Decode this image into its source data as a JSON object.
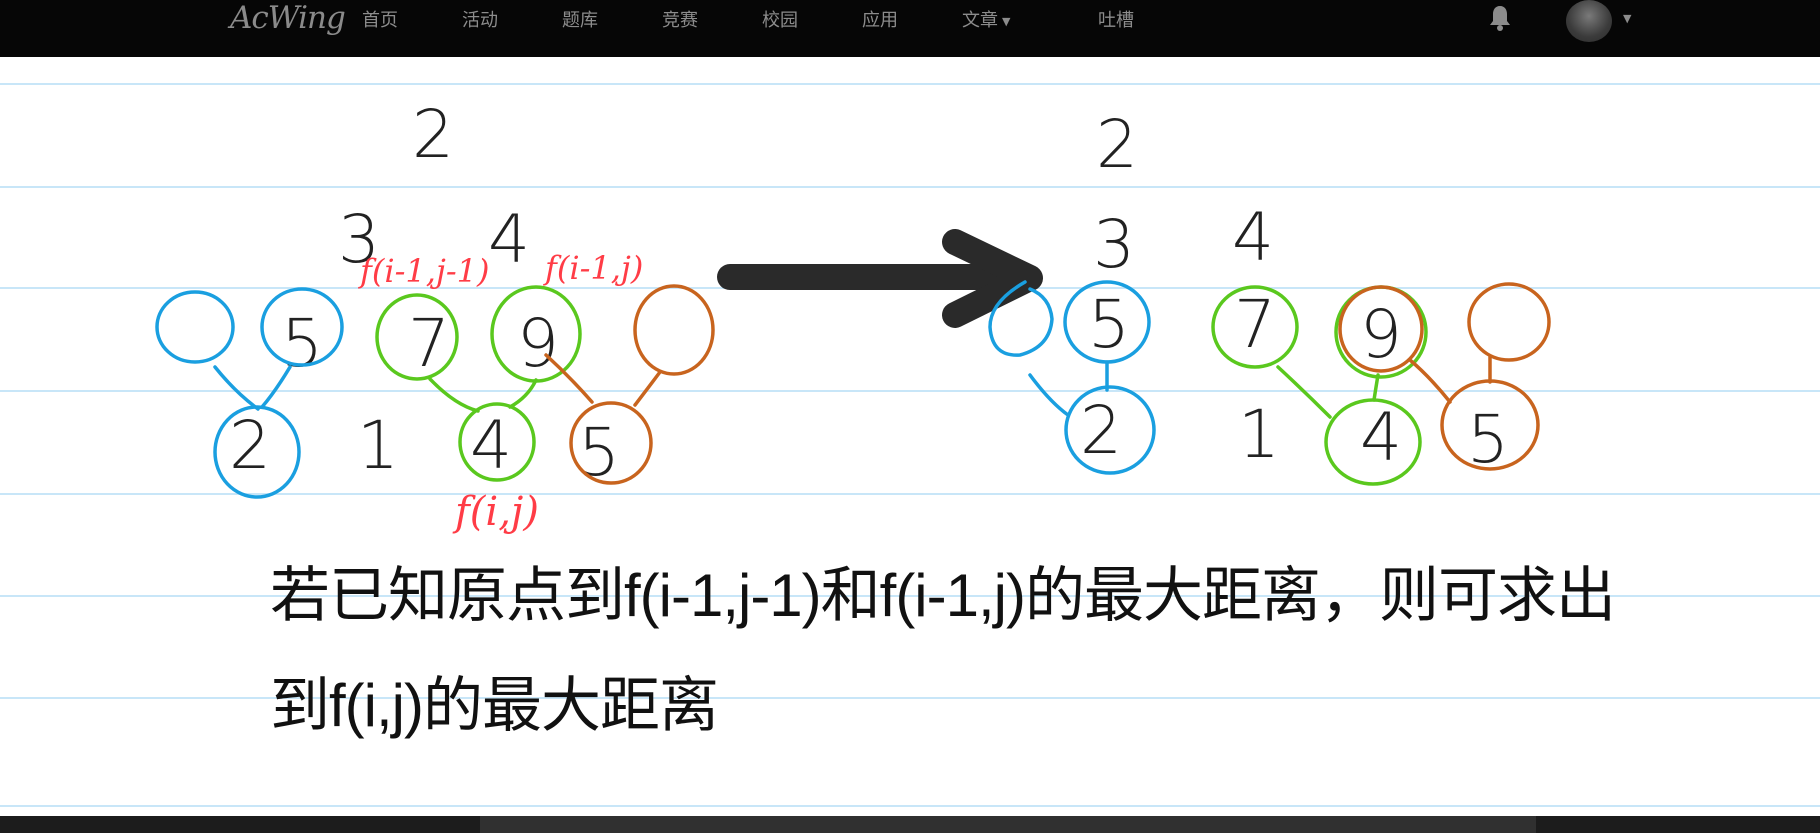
{
  "nav": {
    "logo": "AcWing",
    "items": [
      {
        "label": "首页"
      },
      {
        "label": "活动"
      },
      {
        "label": "题库"
      },
      {
        "label": "竞赛"
      },
      {
        "label": "校园"
      },
      {
        "label": "应用"
      },
      {
        "label": "文章",
        "has_dropdown": true
      },
      {
        "label": "吐槽"
      }
    ],
    "bell_icon": "bell-icon",
    "avatar_icon": "user-avatar",
    "background": "#060606",
    "text_color": "#8c8c8c"
  },
  "board": {
    "left_triangle": {
      "rows": [
        [
          "2"
        ],
        [
          "3",
          "4"
        ],
        [
          "5",
          "7",
          "9"
        ],
        [
          "2",
          "1",
          "4",
          "5"
        ]
      ],
      "annotations": [
        "f(i-1,j-1)",
        "f(i-1,j)",
        "f(i,j)"
      ]
    },
    "right_triangle": {
      "rows": [
        [
          "2"
        ],
        [
          "3",
          "4"
        ],
        [
          "5",
          "7",
          "9"
        ],
        [
          "2",
          "1",
          "4",
          "5"
        ]
      ]
    },
    "caption_line1": "若已知原点到f(i-1,j-1)和f(i-1,j)的最大距离，则可求出",
    "caption_line2": "到f(i,j)的最大距离",
    "colors": {
      "blue": "#1a9fe0",
      "green": "#5ac81e",
      "orange": "#c8641e",
      "red": "#ff3c46",
      "ink": "#222222",
      "rule_line": "#c8e6f8"
    }
  }
}
